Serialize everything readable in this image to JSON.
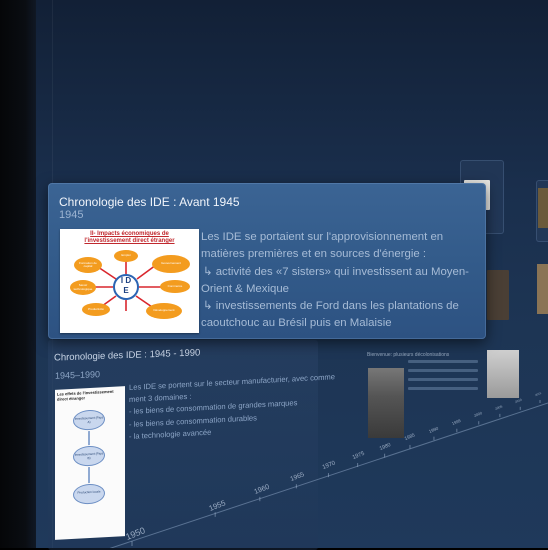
{
  "main_event": {
    "title": "Chronologie des IDE : Avant 1945",
    "date": "1945",
    "description": [
      "Les IDE se portaient sur l'approvisionnement en",
      "matières premières et en sources d'énergie :",
      " ↳  activité des «7 sisters» qui investissent au Moyen-",
      "Orient & Mexique",
      " ↳  investissements de Ford dans les plantations de",
      "caoutchouc au        Brésil puis en Malaisie"
    ],
    "slide": {
      "title_line1": "II- Impacts économiques de",
      "title_line2": "l'investissement direct étranger",
      "center_label": [
        "I D",
        "E"
      ],
      "bubbles": [
        "Emploi",
        "Formation de capital",
        "Savoir technologique",
        "Productivité",
        "Gouvernement",
        "Commerce",
        "Développement",
        "Transfert de technologie"
      ]
    }
  },
  "second_event": {
    "title": "Chronologie des IDE : 1945 - 1990",
    "date": "1945–1990",
    "description": [
      "Les IDE se portent sur le secteur manufacturier, avec comme",
      "ment 3 domaines :",
      "- les biens de consommation de grandes marques",
      "- les biens de consommation durables",
      "- la technologie avancée"
    ],
    "slide_title": "Les effets de l'investissement direct étranger",
    "slide_boxes": [
      "Investissement (Pays A)",
      "Investissement (Pays B)",
      "Production locale"
    ]
  },
  "far_events": {
    "event3_title": "Bienvenue: plusieurs décolonisations"
  },
  "timeline": {
    "years": [
      "1950",
      "1955",
      "1960",
      "1965",
      "1970",
      "1975",
      "1980",
      "1985",
      "1990",
      "1995",
      "2000",
      "2005",
      "2010",
      "2015"
    ]
  },
  "colors": {
    "card_bg": "#325a89",
    "background": "#1a2f4d",
    "slide_bubble": "#f39c1f",
    "slide_title": "#c0272d"
  }
}
